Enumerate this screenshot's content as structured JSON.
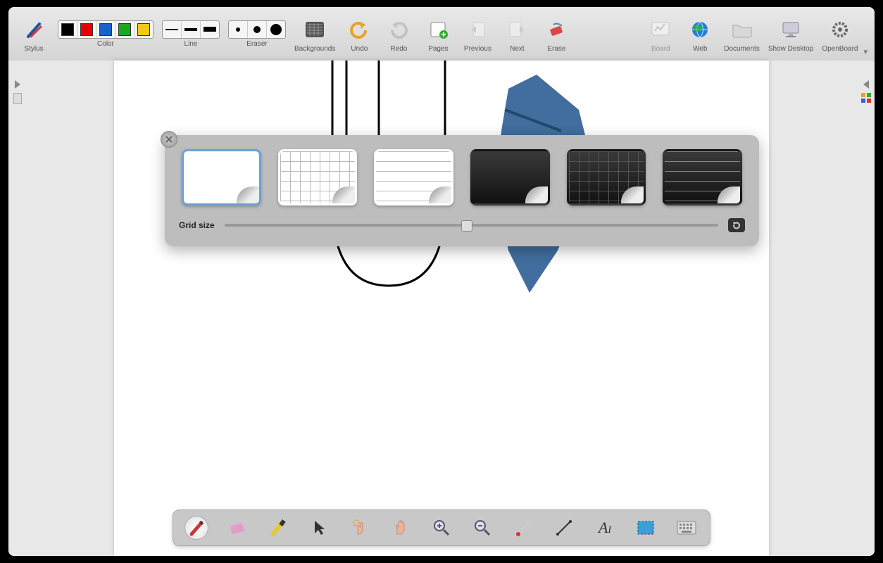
{
  "toolbar": {
    "stylus": "Stylus",
    "color": "Color",
    "line": "Line",
    "eraser": "Eraser",
    "backgrounds": "Backgrounds",
    "undo": "Undo",
    "redo": "Redo",
    "pages": "Pages",
    "previous": "Previous",
    "next": "Next",
    "erase": "Erase",
    "board": "Board",
    "web": "Web",
    "documents": "Documents",
    "show_desktop": "Show Desktop",
    "openboard": "OpenBoard"
  },
  "colors": [
    "#000000",
    "#e60000",
    "#1962c9",
    "#1aa81a",
    "#f2c718"
  ],
  "backgrounds_popup": {
    "grid_size_label": "Grid size",
    "options": [
      "plain-white",
      "grid-white",
      "lined-white",
      "plain-dark",
      "grid-dark",
      "lined-dark"
    ],
    "selected": "plain-white"
  },
  "bottom_tools": [
    "pen",
    "eraser",
    "highlighter",
    "pointer",
    "interact",
    "scroll",
    "zoom-in",
    "zoom-out",
    "laser",
    "line",
    "text",
    "capture",
    "keyboard"
  ],
  "active_tool": "pen"
}
